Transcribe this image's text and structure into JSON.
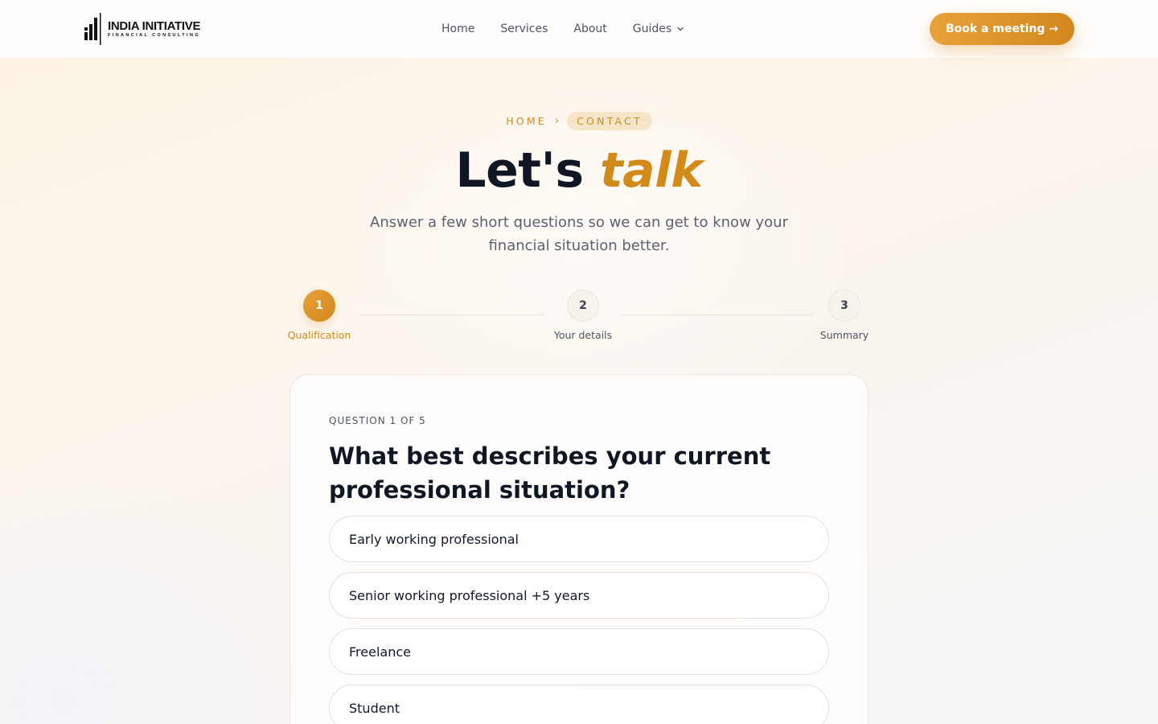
{
  "header": {
    "logo_title": "INDIA INITIATIVE",
    "logo_subtitle": "FINANCIAL CONSULTING",
    "nav": [
      {
        "label": "Home"
      },
      {
        "label": "Services"
      },
      {
        "label": "About"
      },
      {
        "label": "Guides"
      }
    ],
    "cta_label": "Book a meeting →"
  },
  "hero": {
    "breadcrumb_home": "HOME",
    "breadcrumb_sep": "›",
    "breadcrumb_current": "CONTACT",
    "title_plain": "Let's",
    "title_accent": "talk",
    "subtitle": "Answer a few short questions so we can get to know your financial situation better."
  },
  "stepper": {
    "steps": [
      {
        "number": "1",
        "label": "Qualification",
        "active": true
      },
      {
        "number": "2",
        "label": "Your details",
        "active": false
      },
      {
        "number": "3",
        "label": "Summary",
        "active": false
      }
    ]
  },
  "question": {
    "counter": "QUESTION 1 OF 5",
    "text": "What best describes your current professional situation?",
    "options": [
      {
        "label": "Early working professional"
      },
      {
        "label": "Senior working professional +5 years"
      },
      {
        "label": "Freelance"
      },
      {
        "label": "Student"
      }
    ]
  },
  "colors": {
    "accent": "#d28a19",
    "accent_light": "#e8a23a",
    "heading": "#0f1724",
    "muted": "#5b6170"
  }
}
